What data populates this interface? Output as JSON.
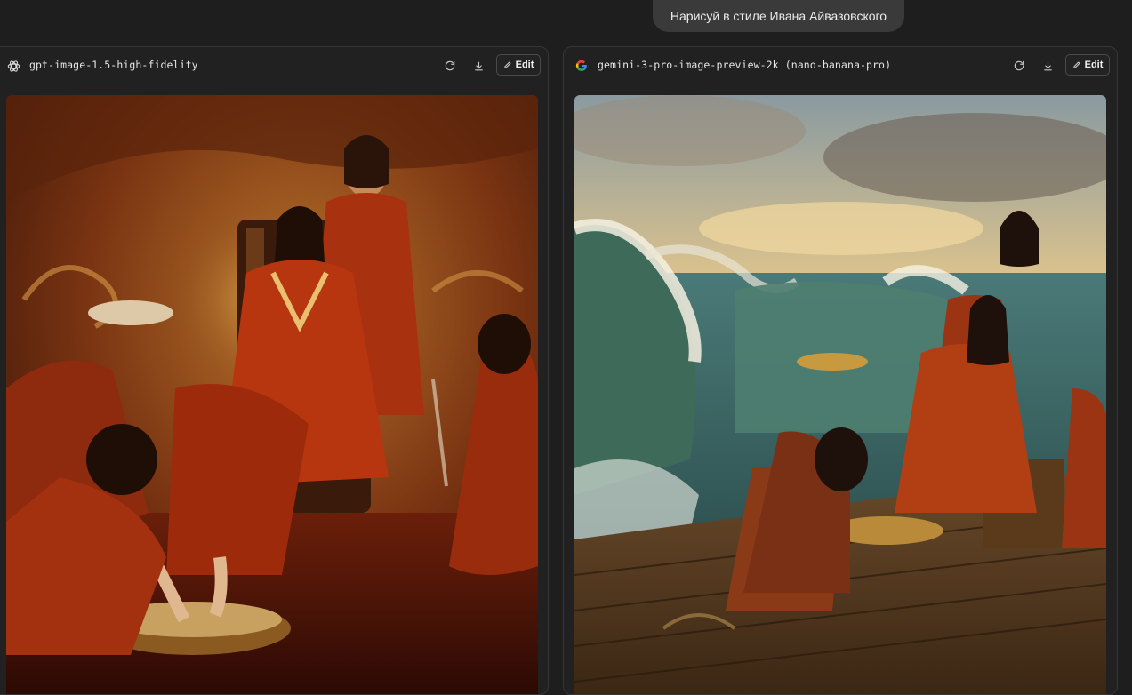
{
  "prompt": {
    "text": "Нарисуй в стиле Ивана Айвазовского"
  },
  "panels": [
    {
      "model_name": "gpt-image-1.5-high-fidelity",
      "icon": "openai-logo-icon",
      "actions": {
        "regenerate_icon": "refresh-icon",
        "download_icon": "download-icon",
        "edit_label": "Edit",
        "edit_icon": "pencil-icon"
      },
      "image_alt": "painting"
    },
    {
      "model_name": "gemini-3-pro-image-preview-2k (nano-banana-pro)",
      "icon": "google-logo-icon",
      "actions": {
        "regenerate_icon": "refresh-icon",
        "download_icon": "download-icon",
        "edit_label": "Edit",
        "edit_icon": "pencil-icon"
      },
      "image_alt": "seascape painting"
    }
  ],
  "colors": {
    "background": "#1e1e1e",
    "panel": "#212121",
    "bubble": "#3a3a3a"
  }
}
